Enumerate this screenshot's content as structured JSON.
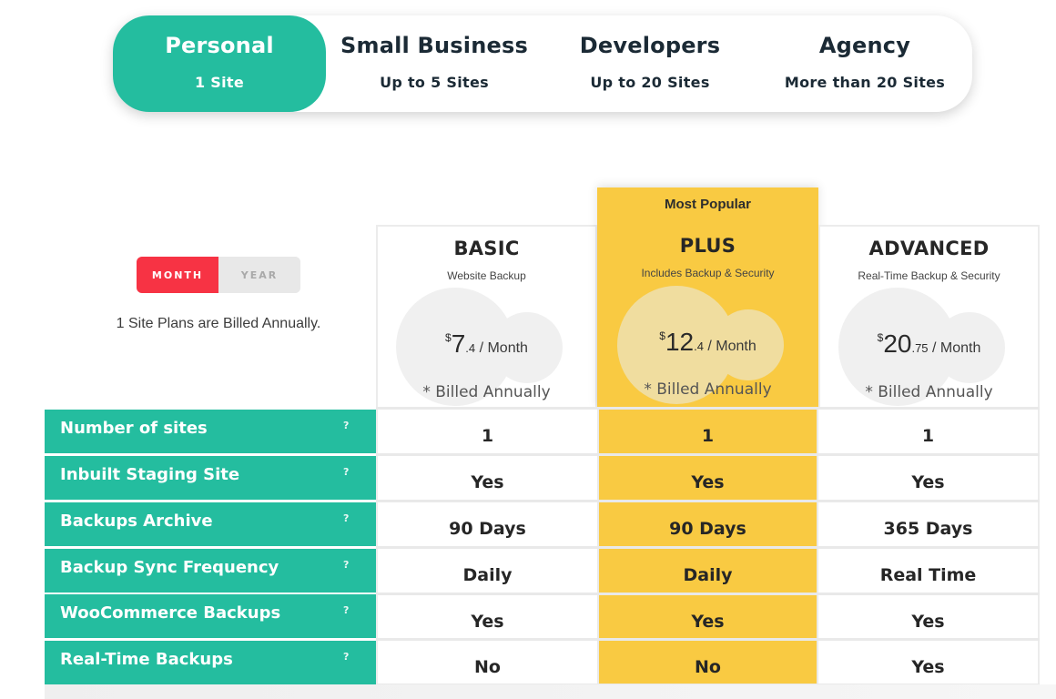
{
  "tabs": [
    {
      "title": "Personal",
      "subtitle": "1 Site",
      "active": true
    },
    {
      "title": "Small Business",
      "subtitle": "Up to 5 Sites",
      "active": false
    },
    {
      "title": "Developers",
      "subtitle": "Up to 20 Sites",
      "active": false
    },
    {
      "title": "Agency",
      "subtitle": "More than 20 Sites",
      "active": false
    }
  ],
  "billing_toggle": {
    "month_label": "MONTH",
    "year_label": "YEAR",
    "selected": "MONTH"
  },
  "billing_note": "1 Site Plans are Billed Annually.",
  "plans": {
    "basic": {
      "name": "BASIC",
      "description": "Website Backup",
      "currency": "$",
      "price_int": "7",
      "price_dec": ".4",
      "period": " / Month",
      "billed_note": "* Billed Annually"
    },
    "plus": {
      "badge": "Most Popular",
      "name": "PLUS",
      "description": "Includes Backup & Security",
      "currency": "$",
      "price_int": "12",
      "price_dec": ".4",
      "period": " / Month",
      "billed_note": "* Billed Annually"
    },
    "advanced": {
      "name": "ADVANCED",
      "description": "Real-Time Backup & Security",
      "currency": "$",
      "price_int": "20",
      "price_dec": ".75",
      "period": " / Month",
      "billed_note": "* Billed Annually"
    }
  },
  "features": [
    {
      "label": "Number of sites",
      "help": "?",
      "basic": "1",
      "plus": "1",
      "advanced": "1"
    },
    {
      "label": "Inbuilt Staging Site",
      "help": "?",
      "basic": "Yes",
      "plus": "Yes",
      "advanced": "Yes"
    },
    {
      "label": "Backups Archive",
      "help": "?",
      "basic": "90 Days",
      "plus": "90 Days",
      "advanced": "365 Days"
    },
    {
      "label": "Backup Sync Frequency",
      "help": "?",
      "basic": "Daily",
      "plus": "Daily",
      "advanced": "Real Time"
    },
    {
      "label": "WooCommerce Backups",
      "help": "?",
      "basic": "Yes",
      "plus": "Yes",
      "advanced": "Yes"
    },
    {
      "label": "Real-Time Backups",
      "help": "?",
      "basic": "No",
      "plus": "No",
      "advanced": "Yes"
    }
  ],
  "colors": {
    "accent_teal": "#24bd9f",
    "highlight_yellow": "#f9ca42",
    "toggle_red": "#f73344"
  }
}
